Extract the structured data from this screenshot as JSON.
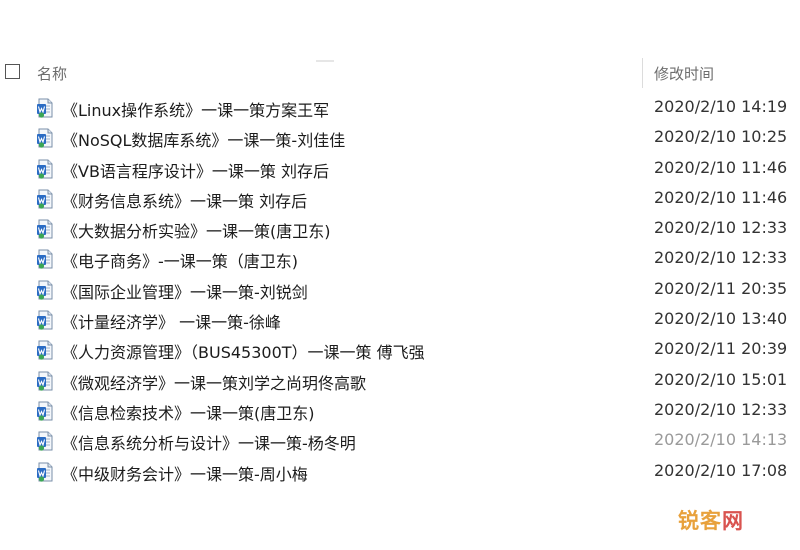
{
  "header": {
    "name_label": "名称",
    "date_label": "修改时间"
  },
  "files": [
    {
      "name": "《Linux操作系统》一课一策方案王军",
      "modified": "2020/2/10 14:19"
    },
    {
      "name": "《NoSQL数据库系统》一课一策-刘佳佳",
      "modified": "2020/2/10 10:25"
    },
    {
      "name": "《VB语言程序设计》一课一策 刘存后",
      "modified": "2020/2/10 11:46"
    },
    {
      "name": "《财务信息系统》一课一策 刘存后",
      "modified": "2020/2/10 11:46"
    },
    {
      "name": "《大数据分析实验》一课一策(唐卫东)",
      "modified": "2020/2/10 12:33"
    },
    {
      "name": "《电子商务》-一课一策（唐卫东)",
      "modified": "2020/2/10 12:33"
    },
    {
      "name": "《国际企业管理》一课一策-刘锐剑",
      "modified": "2020/2/11 20:35"
    },
    {
      "name": "《计量经济学》 一课一策-徐峰",
      "modified": "2020/2/10 13:40"
    },
    {
      "name": "《人力资源管理》（BUS45300T）一课一策 傅飞强",
      "modified": "2020/2/11 20:39"
    },
    {
      "name": "《微观经济学》一课一策刘学之尚玥佟高歌",
      "modified": "2020/2/10 15:01"
    },
    {
      "name": "《信息检索技术》一课一策(唐卫东)",
      "modified": "2020/2/10 12:33"
    },
    {
      "name": "《信息系统分析与设计》一课一策-杨冬明",
      "modified": "2020/2/10 14:13"
    },
    {
      "name": "《中级财务会计》一课一策-周小梅",
      "modified": "2020/2/10 17:08"
    }
  ],
  "icon": "word-document-icon",
  "watermark": {
    "part1": "锐客",
    "part2": "网"
  },
  "colors": {
    "icon_blue": "#2b6cc4",
    "icon_green": "#3aa655",
    "header_text": "#6d6d6d",
    "watermark": "#e8a13c"
  }
}
